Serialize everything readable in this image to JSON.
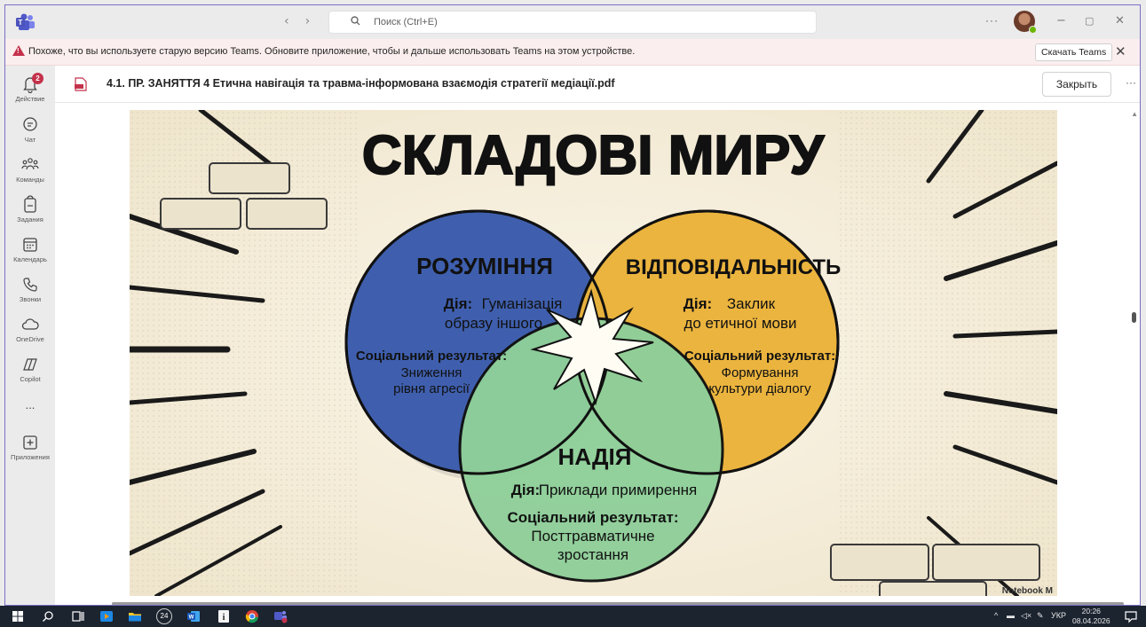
{
  "titlebar": {
    "search_placeholder": "Поиск (Ctrl+E)",
    "back_glyph": "‹",
    "forward_glyph": "›",
    "more_glyph": "···",
    "minimize_glyph": "−",
    "restore_glyph": "▢",
    "close_glyph": "✕"
  },
  "banner": {
    "message": "Похоже, что вы используете старую версию Teams. Обновите приложение, чтобы и дальше использовать Teams на этом устройстве.",
    "download_label": "Скачать Teams",
    "close_glyph": "✕"
  },
  "rail": {
    "activity_badge": "2",
    "items": [
      {
        "label": "Действие",
        "icon": "bell-icon"
      },
      {
        "label": "Чат",
        "icon": "chat-icon"
      },
      {
        "label": "Команды",
        "icon": "teams-icon"
      },
      {
        "label": "Задания",
        "icon": "assignments-icon"
      },
      {
        "label": "Календарь",
        "icon": "calendar-icon"
      },
      {
        "label": "Звонки",
        "icon": "phone-icon"
      },
      {
        "label": "OneDrive",
        "icon": "cloud-icon"
      },
      {
        "label": "Copilot",
        "icon": "copilot-icon"
      },
      {
        "label": "...",
        "icon": "more-icon"
      },
      {
        "label": "Приложения",
        "icon": "apps-plus-icon"
      }
    ]
  },
  "document": {
    "title": "4.1. ПР. ЗАНЯТТЯ 4 Етична навігація та травма-інформована взаємодія стратегії медіації.pdf",
    "close_label": "Закрыть",
    "more_glyph": "···"
  },
  "slide": {
    "heading": "СКЛАДОВІ МИРУ",
    "circle_left": {
      "title": "РОЗУМІННЯ",
      "action_label": "Дія:",
      "action_text_1": "Гуманізація",
      "action_text_2": "образу іншого",
      "result_label": "Соціальний результат:",
      "result_text_1": "Зниження",
      "result_text_2": "рівня агресії",
      "color": "#3f5fae"
    },
    "circle_right": {
      "title": "ВІДПОВІДАЛЬНІСТЬ",
      "action_label": "Дія:",
      "action_text_1": "Заклик",
      "action_text_2": "до етичної мови",
      "result_label": "Соціальний результат:",
      "result_text_1": "Формування",
      "result_text_2": "культури діалогу",
      "color": "#ebb33b"
    },
    "circle_bottom": {
      "title": "НАДІЯ",
      "action_label": "Дія:",
      "action_text": "Приклади примирення",
      "result_label": "Соціальний результат:",
      "result_text_1": "Посттравматичне",
      "result_text_2": "зростання",
      "color": "#8fcf9a"
    },
    "watermark": "Notebook M"
  },
  "taskbar": {
    "lang": "УКР",
    "time": "20:26",
    "date": "08.04.2026",
    "badge": "24"
  }
}
